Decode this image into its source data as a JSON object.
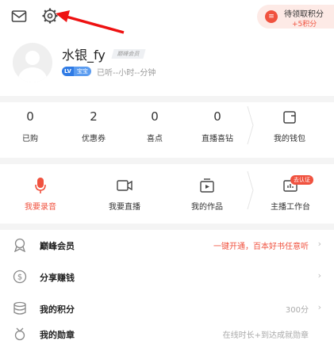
{
  "header": {
    "points_title": "待领取积分",
    "points_sub": "+5积分"
  },
  "profile": {
    "name": "水银_fy",
    "member_badge": "巅峰会员",
    "lv_badge": "LV",
    "level_name": "宝宝",
    "listen_time": "已听--小时--分钟"
  },
  "stats": [
    {
      "value": "0",
      "label": "已购"
    },
    {
      "value": "2",
      "label": "优惠券"
    },
    {
      "value": "0",
      "label": "喜点"
    },
    {
      "value": "0",
      "label": "直播喜钻"
    }
  ],
  "wallet_label": "我的钱包",
  "actions": [
    {
      "label": "我要录音"
    },
    {
      "label": "我要直播"
    },
    {
      "label": "我的作品"
    },
    {
      "label": "主播工作台",
      "badge": "去认证"
    }
  ],
  "list": [
    {
      "title": "巅峰会员",
      "right": "一键开通，百本好书任意听"
    },
    {
      "title": "分享赚钱",
      "right": ""
    },
    {
      "title": "我的积分",
      "right": "300分"
    },
    {
      "title": "我的勋章",
      "right": "在线时长+到达成就勋章"
    }
  ],
  "colors": {
    "accent": "#f0523f",
    "points_bg": "#fdeae6",
    "blue": "#2f7be5"
  }
}
